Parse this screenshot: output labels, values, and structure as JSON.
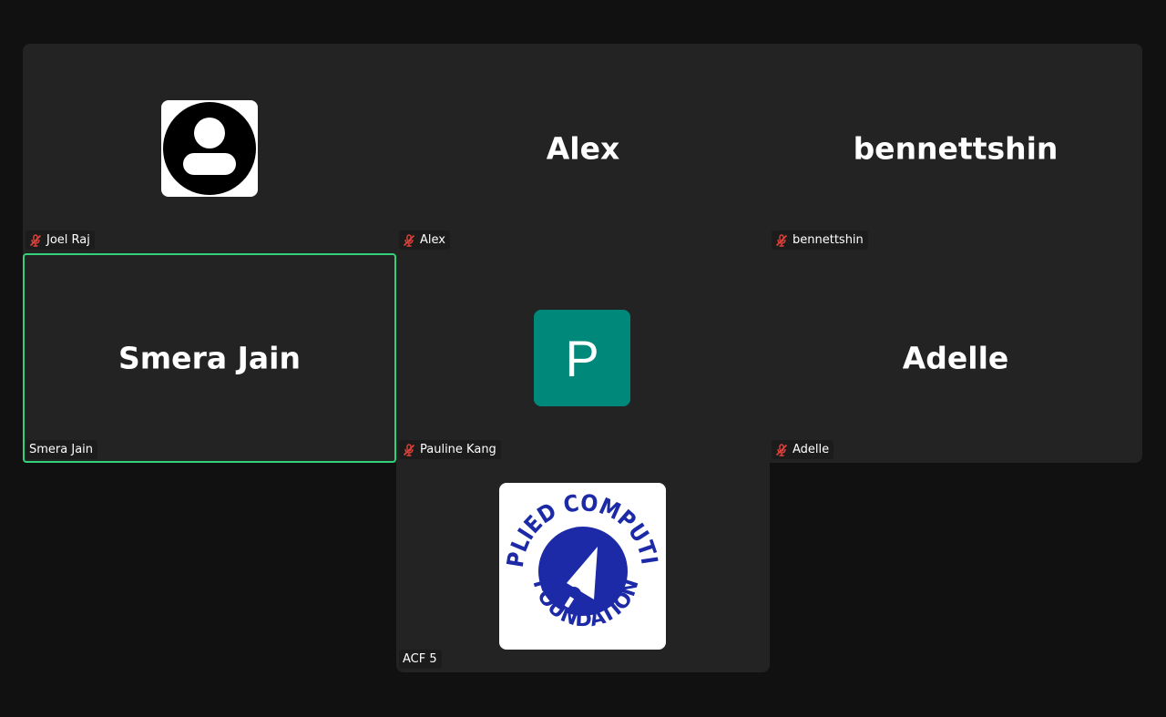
{
  "colors": {
    "background": "#111111",
    "tile": "#232323",
    "active_speaker_border": "#33d17a",
    "muted_mic": "#e0413a",
    "pauline_avatar": "#00897b",
    "acf_logo": "#1d2aa8"
  },
  "participants": [
    {
      "name": "Joel Raj",
      "label": "Joel Raj",
      "muted": true,
      "display": "generic-avatar"
    },
    {
      "name": "Alex",
      "label": "Alex",
      "muted": true,
      "display": "name-text"
    },
    {
      "name": "bennettshin",
      "label": "bennettshin",
      "muted": true,
      "display": "name-text"
    },
    {
      "name": "Smera Jain",
      "label": "Smera Jain",
      "muted": false,
      "active_speaker": true,
      "display": "name-text"
    },
    {
      "name": "Pauline Kang",
      "label": "Pauline Kang",
      "muted": true,
      "display": "letter-avatar",
      "avatar_letter": "P"
    },
    {
      "name": "Adelle",
      "label": "Adelle",
      "muted": true,
      "display": "name-text"
    },
    {
      "name": "ACF 5",
      "label": "ACF 5",
      "muted": false,
      "display": "logo",
      "logo_text": {
        "top": "APPLIED COMPUTING",
        "bottom": "FOUNDATION"
      }
    }
  ]
}
